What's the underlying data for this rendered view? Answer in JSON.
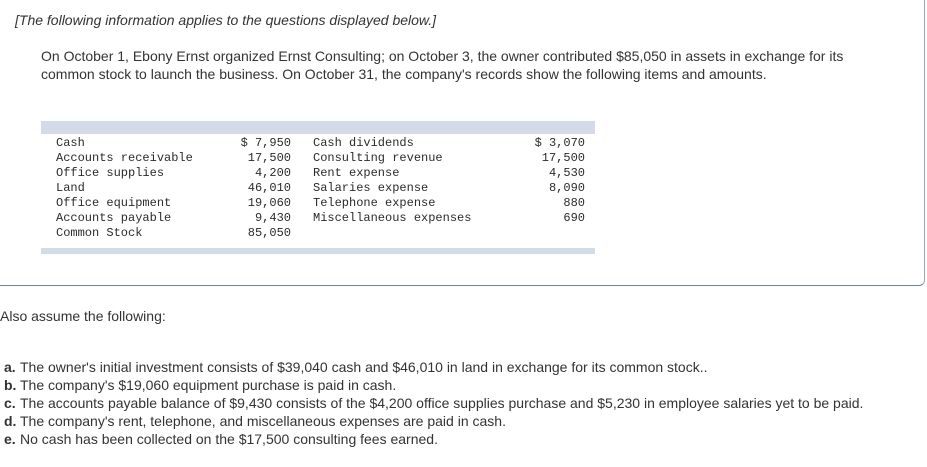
{
  "intro_note": "[The following information applies to the questions displayed below.]",
  "intro_paragraph": "On October 1, Ebony Ernst organized Ernst Consulting; on October 3, the owner contributed $85,050 in assets in exchange for its common stock to launch the business. On October 31, the company's records show the following items and amounts.",
  "ledger": {
    "left": [
      {
        "label": "Cash",
        "value": "$ 7,950"
      },
      {
        "label": "Accounts receivable",
        "value": "17,500"
      },
      {
        "label": "Office supplies",
        "value": "4,200"
      },
      {
        "label": "Land",
        "value": "46,010"
      },
      {
        "label": "Office equipment",
        "value": "19,060"
      },
      {
        "label": "Accounts payable",
        "value": "9,430"
      },
      {
        "label": "Common Stock",
        "value": "85,050"
      }
    ],
    "right": [
      {
        "label": "Cash dividends",
        "value": "$ 3,070"
      },
      {
        "label": "Consulting revenue",
        "value": "17,500"
      },
      {
        "label": "Rent expense",
        "value": "4,530"
      },
      {
        "label": "Salaries expense",
        "value": "8,090"
      },
      {
        "label": "Telephone expense",
        "value": "880"
      },
      {
        "label": "Miscellaneous expenses",
        "value": "690"
      }
    ]
  },
  "also_assume": "Also assume the following:",
  "assumptions": [
    {
      "letter": "a.",
      "text": "The owner's initial investment consists of $39,040 cash and $46,010 in land in exchange for its common stock.."
    },
    {
      "letter": "b.",
      "text": "The company's $19,060 equipment purchase is paid in cash."
    },
    {
      "letter": "c.",
      "text": "The accounts payable balance of $9,430 consists of the $4,200 office supplies purchase and $5,230 in employee salaries yet to be paid."
    },
    {
      "letter": "d.",
      "text": "The company's rent, telephone, and miscellaneous expenses are paid in cash."
    },
    {
      "letter": "e.",
      "text": "No cash has been collected on the $17,500 consulting fees earned."
    }
  ]
}
